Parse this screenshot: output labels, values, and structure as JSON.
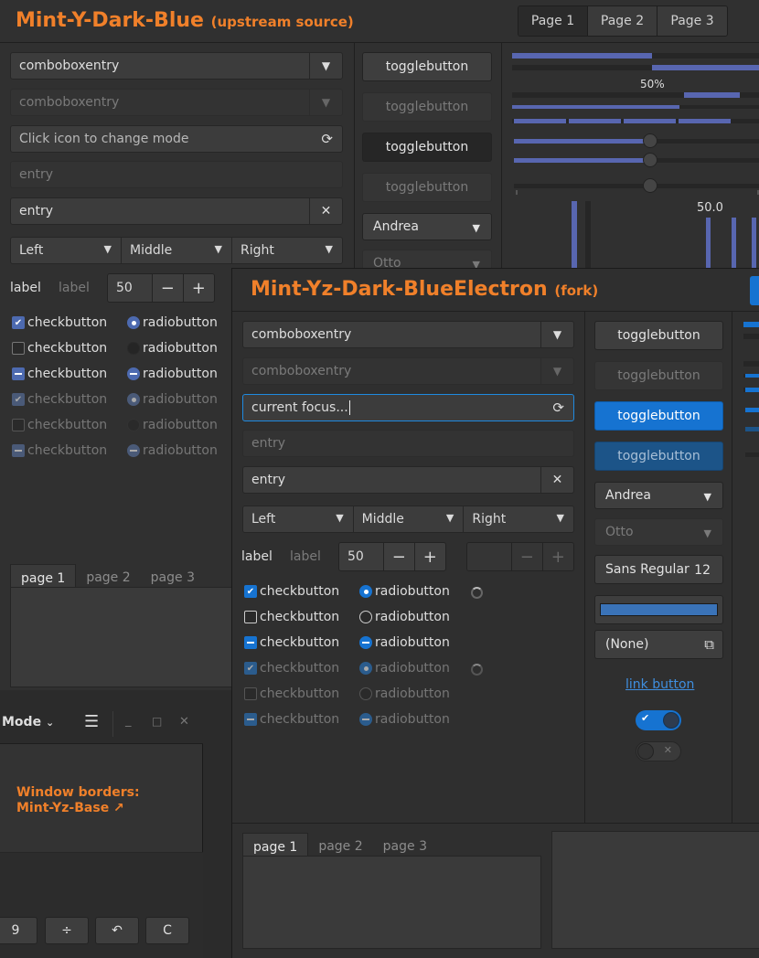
{
  "win1": {
    "title": "Mint-Y-Dark-Blue",
    "title_note": "(upstream source)",
    "page_tabs": [
      "Page 1",
      "Page 2",
      "Page 3"
    ],
    "combo_entry": "comboboxentry",
    "combo_entry_disabled": "comboboxentry",
    "mode_entry_placeholder": "Click icon to change mode",
    "entry_disabled_placeholder": "entry",
    "entry_value": "entry",
    "segmented": [
      "Left",
      "Middle",
      "Right"
    ],
    "label": "label",
    "label_disabled": "label",
    "spin_value": "50",
    "toggles": [
      "togglebutton",
      "togglebutton",
      "togglebutton",
      "togglebutton"
    ],
    "combo_andrea": "Andrea",
    "combo_otto": "Otto",
    "check_label": "checkbutton",
    "radio_label": "radiobutton",
    "progress_label": "50%",
    "scale_value": "50.0",
    "notebook_tabs": [
      "page 1",
      "page 2",
      "page 3"
    ]
  },
  "win2": {
    "title": "Mint-Yz-Dark-BlueElectron",
    "title_note": "(fork)",
    "combo_entry": "comboboxentry",
    "combo_entry_disabled": "comboboxentry",
    "focus_entry": "current focus...",
    "entry_disabled_placeholder": "entry",
    "entry_value": "entry",
    "segmented": [
      "Left",
      "Middle",
      "Right"
    ],
    "label": "label",
    "label_disabled": "label",
    "spin_value": "50",
    "toggles": [
      "togglebutton",
      "togglebutton",
      "togglebutton",
      "togglebutton"
    ],
    "combo_andrea": "Andrea",
    "combo_otto": "Otto",
    "font_button": "Sans Regular",
    "font_size": "12",
    "file_chooser": "(None)",
    "link_button": "link button",
    "check_label": "checkbutton",
    "radio_label": "radiobutton",
    "notebook_tabs": [
      "page 1",
      "page 2",
      "page 3"
    ],
    "accent_color": "#1673d1",
    "color_button_value": "#3a73b8"
  },
  "win3": {
    "mode_label": "Mode",
    "note_line1": "Window borders:",
    "note_line2": "Mint-Yz-Base ↗",
    "calc_keys": [
      "9",
      "÷",
      "↶",
      "C"
    ]
  }
}
